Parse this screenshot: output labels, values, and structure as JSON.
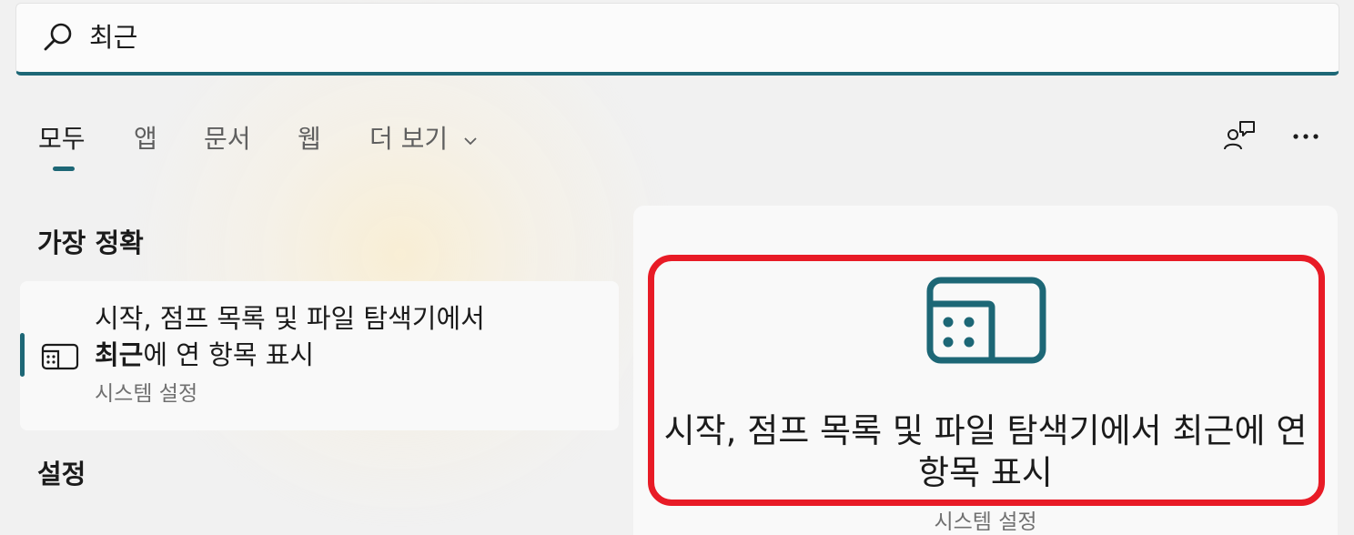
{
  "search": {
    "query": "최근",
    "icon": "search-icon"
  },
  "tabs": [
    {
      "label": "모두",
      "active": true
    },
    {
      "label": "앱",
      "active": false
    },
    {
      "label": "문서",
      "active": false
    },
    {
      "label": "웹",
      "active": false
    },
    {
      "label": "더 보기",
      "active": false
    }
  ],
  "toolbar": {
    "feedback_icon": "feedback-icon",
    "more_icon": "more-icon"
  },
  "best_match": {
    "heading": "가장 정확",
    "result": {
      "title_prefix": "시작, 점프 목록 및 파일 탐색기에서 ",
      "title_highlight": "최근",
      "title_suffix": "에 연 항목 표시",
      "subtitle": "시스템 설정",
      "icon": "settings-layout-icon"
    }
  },
  "settings_section": {
    "heading": "설정"
  },
  "preview": {
    "title": "시작, 점프 목록 및 파일 탐색기에서 최근에 연 항목 표시",
    "subtitle": "시스템 설정",
    "icon": "settings-layout-icon"
  },
  "colors": {
    "accent": "#1d6776",
    "highlight_border": "#e81b26"
  }
}
